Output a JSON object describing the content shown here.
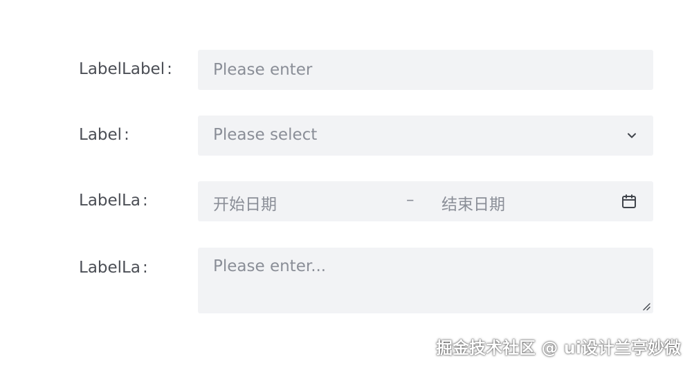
{
  "form": {
    "rows": [
      {
        "label": "LabelLabel",
        "colon": ":",
        "placeholder": "Please enter"
      },
      {
        "label": "Label",
        "colon": ":",
        "placeholder": "Please select"
      },
      {
        "label": "LabelLa",
        "colon": ":",
        "start_placeholder": "开始日期",
        "separator": "–",
        "end_placeholder": "结束日期"
      },
      {
        "label": "LabelLa",
        "colon": ":",
        "placeholder": "Please enter..."
      }
    ]
  },
  "icons": {
    "select": "chevron-down-icon",
    "date": "calendar-icon",
    "textarea": "resize-handle-icon"
  },
  "colors": {
    "field_background": "#f2f3f5",
    "label_text": "#4b4e55",
    "placeholder_text": "#8a8e97"
  },
  "watermark": "掘金技术社区 @ ui设计兰亭妙微"
}
